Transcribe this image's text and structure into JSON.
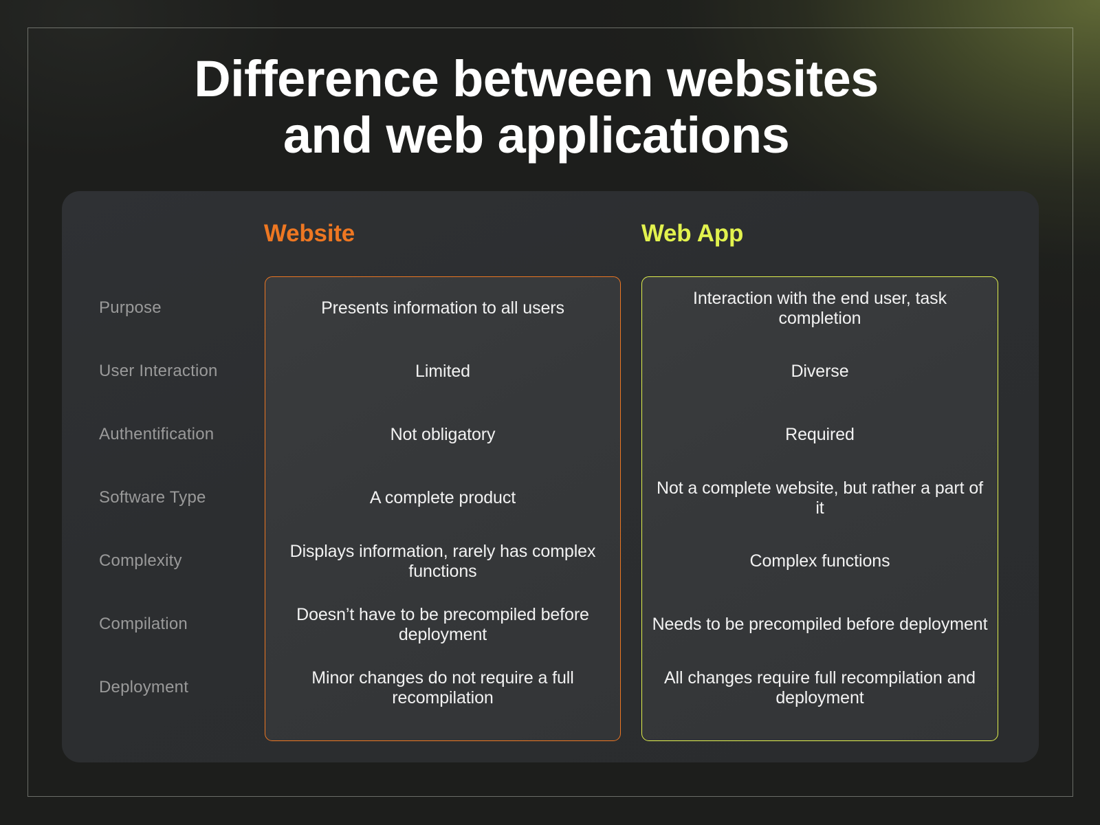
{
  "title": {
    "line1": "Difference between websites",
    "line2": "and web applications"
  },
  "colors": {
    "website_accent": "#ee7722",
    "webapp_accent": "#e2f24e",
    "page_background": "#1d1e1c",
    "panel_background": "#2c2e30",
    "box_background": "#37393b",
    "label_text": "#9a9a9a",
    "value_text": "#f2f2f2",
    "frame_border": "#cdd0c6"
  },
  "table": {
    "columns": [
      {
        "label": "Website",
        "accent": "#ee7722"
      },
      {
        "label": "Web App",
        "accent": "#e2f24e"
      }
    ],
    "rows": [
      {
        "label": "Purpose",
        "website": "Presents information to all users",
        "webapp": "Interaction with the end user, task completion"
      },
      {
        "label": "User Interaction",
        "website": "Limited",
        "webapp": "Diverse"
      },
      {
        "label": "Authentification",
        "website": "Not obligatory",
        "webapp": "Required"
      },
      {
        "label": "Software Type",
        "website": "A complete product",
        "webapp": "Not a complete website, but rather a part of it"
      },
      {
        "label": "Complexity",
        "website": "Displays information, rarely has complex functions",
        "webapp": "Complex functions"
      },
      {
        "label": "Compilation",
        "website": "Doesn’t have to be precompiled before deployment",
        "webapp": "Needs to be precompiled before deployment"
      },
      {
        "label": "Deployment",
        "website": "Minor changes do not require a full recompilation",
        "webapp": "All changes require full recompilation and deployment"
      }
    ]
  }
}
